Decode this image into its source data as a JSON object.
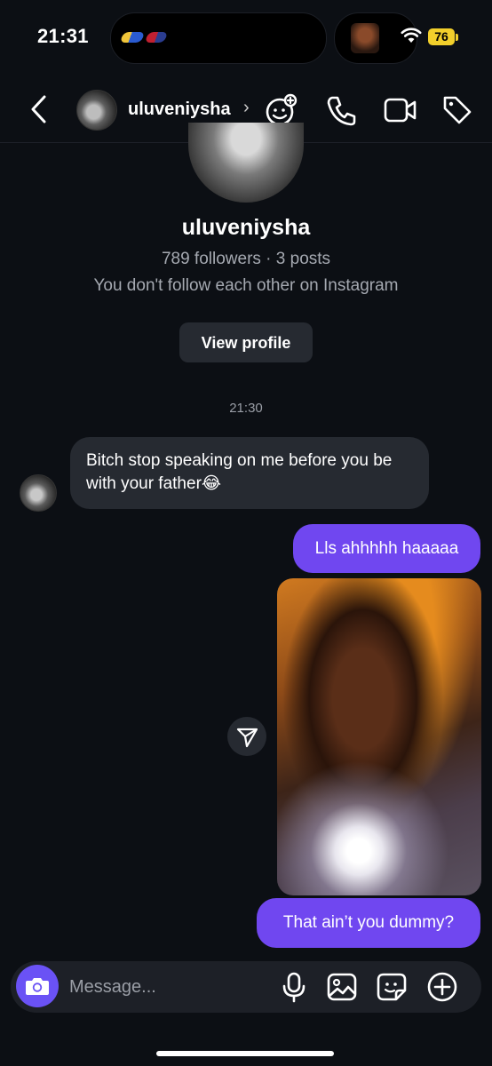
{
  "status_bar": {
    "time": "21:31",
    "battery": "76"
  },
  "header": {
    "username": "uluveniysha",
    "icons": [
      "back-chevron-icon",
      "avatar",
      "chevron-right-icon",
      "effects-face-icon",
      "phone-icon",
      "video-icon",
      "tag-icon"
    ]
  },
  "profile": {
    "name": "uluveniysha",
    "stats": "789 followers · 3 posts",
    "follow_status": "You don't follow each other on Instagram",
    "view_profile_label": "View profile"
  },
  "thread": {
    "timestamp": "21:30",
    "messages": [
      {
        "from": "them",
        "text": "Bitch stop speaking on me before you be with your father😂"
      },
      {
        "from": "me",
        "text": "Lls ahhhhh haaaaa"
      },
      {
        "from": "me",
        "type": "photo"
      },
      {
        "from": "me",
        "text": "That ain’t you dummy?"
      }
    ]
  },
  "composer": {
    "placeholder": "Message...",
    "icons": [
      "camera-icon",
      "microphone-icon",
      "image-icon",
      "sticker-icon",
      "plus-icon"
    ]
  },
  "colors": {
    "background": "#0c0f14",
    "incoming_bubble": "#262a31",
    "outgoing_bubble": "#7047f0",
    "camera_button": "#6a52f5",
    "battery": "#f2cf2b"
  }
}
